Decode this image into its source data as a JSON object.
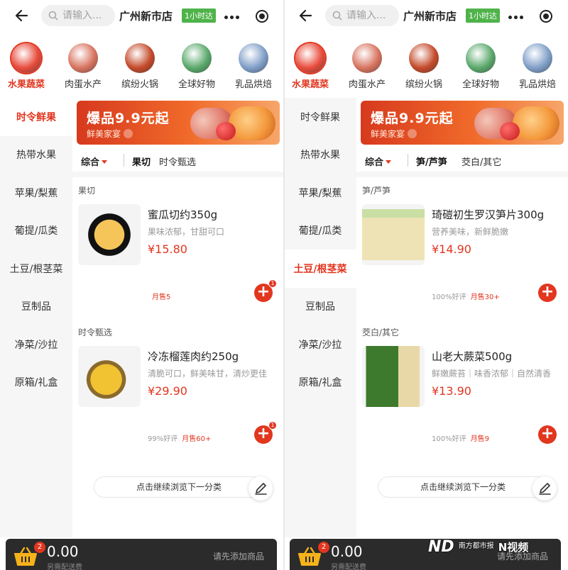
{
  "panels": [
    {
      "header": {
        "search_placeholder": "请输入...",
        "store": "广州新市店",
        "badge": "1小时达"
      },
      "top_categories": [
        {
          "label": "水果蔬菜",
          "active": true,
          "color": "#e84c3d"
        },
        {
          "label": "肉蛋水产",
          "active": false,
          "color": "#d8735f"
        },
        {
          "label": "缤纷火锅",
          "active": false,
          "color": "#c44a2a"
        },
        {
          "label": "全球好物",
          "active": false,
          "color": "#5aa86b"
        },
        {
          "label": "乳品烘焙",
          "active": false,
          "color": "#7f9ec8"
        }
      ],
      "side_nav": [
        {
          "label": "时令鲜果",
          "active": true
        },
        {
          "label": "热带水果",
          "active": false
        },
        {
          "label": "苹果/梨蕉",
          "active": false
        },
        {
          "label": "葡提/瓜类",
          "active": false
        },
        {
          "label": "土豆/根茎菜",
          "active": false
        },
        {
          "label": "豆制品",
          "active": false
        },
        {
          "label": "净菜/沙拉",
          "active": false
        },
        {
          "label": "原箱/礼盒",
          "active": false
        }
      ],
      "banner": {
        "title": "爆品9.9元起",
        "subtitle": "鲜美家宴"
      },
      "tabs": {
        "sort": "综合",
        "items": [
          {
            "label": "果切",
            "active": true
          },
          {
            "label": "时令甄选",
            "active": false
          }
        ]
      },
      "sections": [
        {
          "title": "果切",
          "product": {
            "name": "蜜瓜切约350g",
            "desc": "果味浓郁，甘甜可口",
            "price": "¥15.80",
            "rating": "",
            "sold": "月售5",
            "cart_count": "1"
          }
        },
        {
          "title": "时令甄选",
          "product": {
            "name": "冷冻榴莲肉约250g",
            "desc": "清脆可口，鲜美味甘，清炒更佳",
            "price": "¥29.90",
            "rating": "99%好评",
            "sold": "月售60+",
            "cart_count": "1"
          }
        }
      ],
      "more": "点击继续浏览下一分类",
      "cart": {
        "count": "2",
        "total": "0.00",
        "shipping": "另需配送费",
        "button": "请先添加商品"
      }
    },
    {
      "header": {
        "search_placeholder": "请输入...",
        "store": "广州新市店",
        "badge": "1小时达"
      },
      "top_categories": [
        {
          "label": "水果蔬菜",
          "active": true,
          "color": "#e84c3d"
        },
        {
          "label": "肉蛋水产",
          "active": false,
          "color": "#d8735f"
        },
        {
          "label": "缤纷火锅",
          "active": false,
          "color": "#c44a2a"
        },
        {
          "label": "全球好物",
          "active": false,
          "color": "#5aa86b"
        },
        {
          "label": "乳品烘焙",
          "active": false,
          "color": "#7f9ec8"
        }
      ],
      "side_nav": [
        {
          "label": "时令鲜果",
          "active": false
        },
        {
          "label": "热带水果",
          "active": false
        },
        {
          "label": "苹果/梨蕉",
          "active": false
        },
        {
          "label": "葡提/瓜类",
          "active": false
        },
        {
          "label": "土豆/根茎菜",
          "active": true
        },
        {
          "label": "豆制品",
          "active": false
        },
        {
          "label": "净菜/沙拉",
          "active": false
        },
        {
          "label": "原箱/礼盒",
          "active": false
        }
      ],
      "banner": {
        "title": "爆品9.9元起",
        "subtitle": "鲜美家宴"
      },
      "tabs": {
        "sort": "综合",
        "items": [
          {
            "label": "笋/芦笋",
            "active": true
          },
          {
            "label": "茭白/其它",
            "active": false
          }
        ]
      },
      "sections": [
        {
          "title": "笋/芦笋",
          "product": {
            "name": "琦磑初生罗汉笋片300g",
            "desc": "营养美味，新鲜脆嫩",
            "price": "¥14.90",
            "rating": "100%好评",
            "sold": "月售30+",
            "cart_count": ""
          }
        },
        {
          "title": "茭白/其它",
          "product": {
            "name": "山老大蕨菜500g",
            "desc": "鲜嫩蕨苔｜味香浓郁｜自然清香",
            "price": "¥13.90",
            "rating": "100%好评",
            "sold": "月售9",
            "cart_count": ""
          }
        }
      ],
      "more": "点击继续浏览下一分类",
      "cart": {
        "count": "2",
        "total": "0.00",
        "shipping": "另需配送费",
        "button": "请先添加商品"
      }
    }
  ],
  "watermark": {
    "logo": "ND",
    "outlet": "南方都市报",
    "video": "N视频"
  },
  "colors": {
    "accent": "#e2361f",
    "badge_green": "#4fb34a",
    "cart_bar": "#2b2b2b"
  }
}
